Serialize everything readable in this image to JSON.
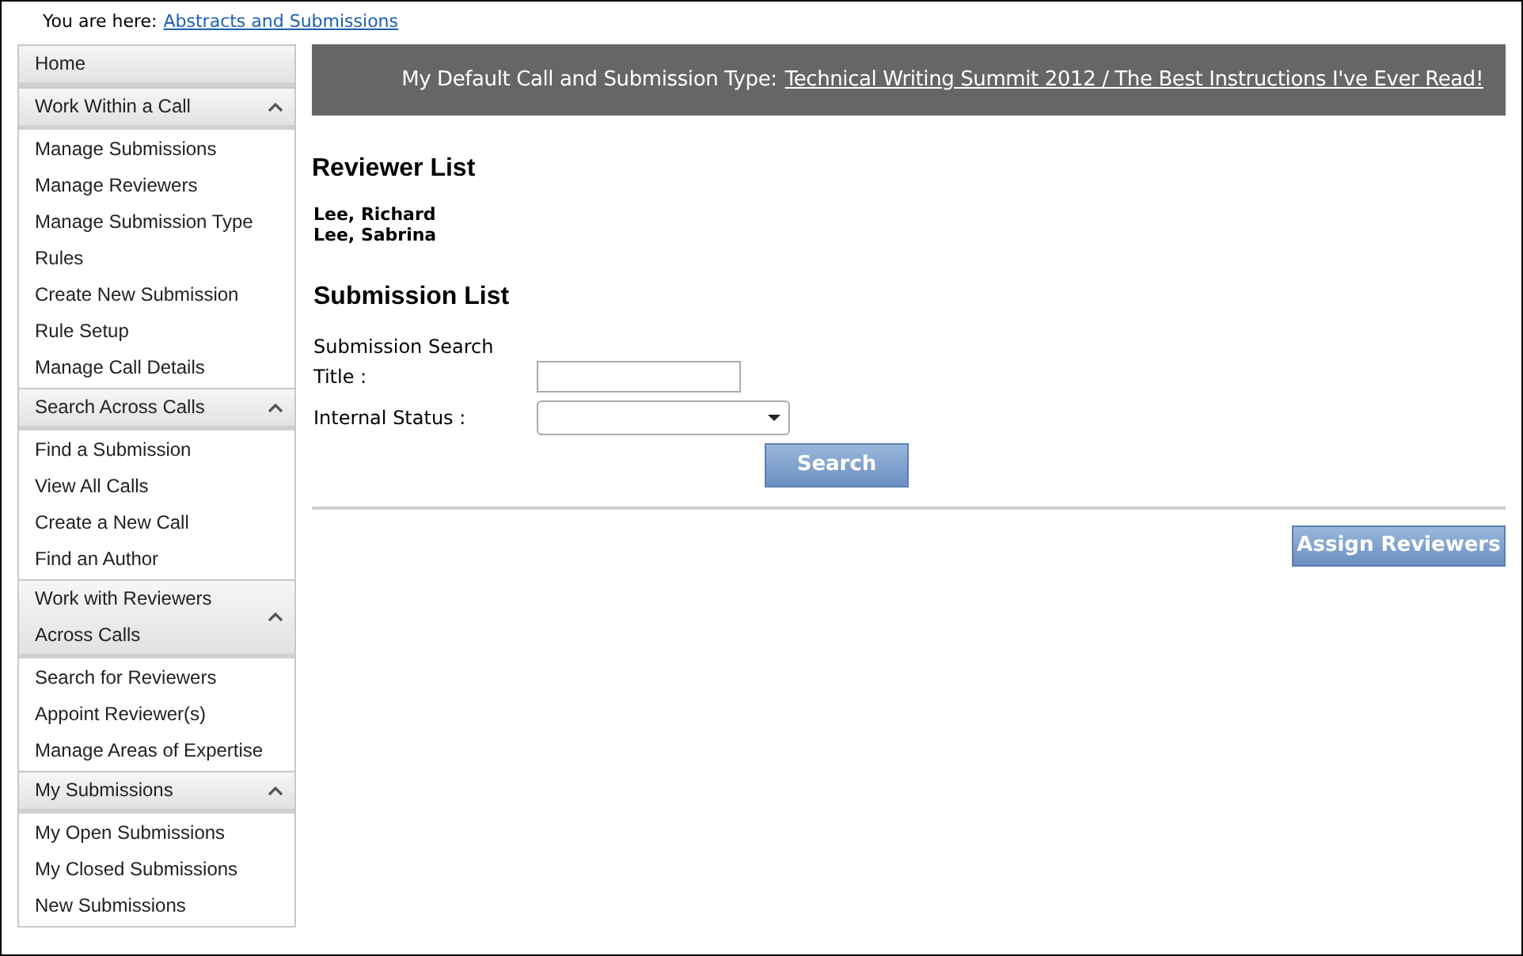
{
  "breadcrumb": {
    "label": "You are here:",
    "link": "Abstracts and Submissions"
  },
  "sidebar": {
    "sections": [
      {
        "title": "Home"
      },
      {
        "title": "Work Within a Call",
        "expanded": true,
        "items": [
          "Manage Submissions",
          "Manage Reviewers",
          "Manage Submission Type",
          "Rules",
          "Create New Submission",
          "Rule Setup",
          "Manage Call Details"
        ]
      },
      {
        "title": "Search Across Calls",
        "expanded": true,
        "items": [
          "Find a Submission",
          "View All Calls",
          "Create a New Call",
          "Find an Author"
        ]
      },
      {
        "title": "Work with Reviewers Across Calls",
        "expanded": true,
        "items": [
          "Search for Reviewers",
          "Appoint Reviewer(s)",
          "Manage Areas of Expertise"
        ]
      },
      {
        "title": "My Submissions",
        "expanded": true,
        "items": [
          "My Open Submissions",
          "My Closed Submissions",
          "New Submissions"
        ]
      }
    ]
  },
  "banner": {
    "label": "My Default Call and Submission Type:",
    "link": "Technical Writing Summit 2012 / The Best Instructions I've Ever Read!"
  },
  "reviewer_list": {
    "heading": "Reviewer List",
    "names": [
      "Lee, Richard",
      "Lee, Sabrina"
    ]
  },
  "submission_list": {
    "heading": "Submission List",
    "search_label": "Submission Search",
    "fields": [
      {
        "kind": "text",
        "label": "Title :"
      },
      {
        "kind": "select",
        "label": "Internal Status :"
      }
    ],
    "search_button": "Search"
  },
  "assign_button": "Assign Reviewers"
}
